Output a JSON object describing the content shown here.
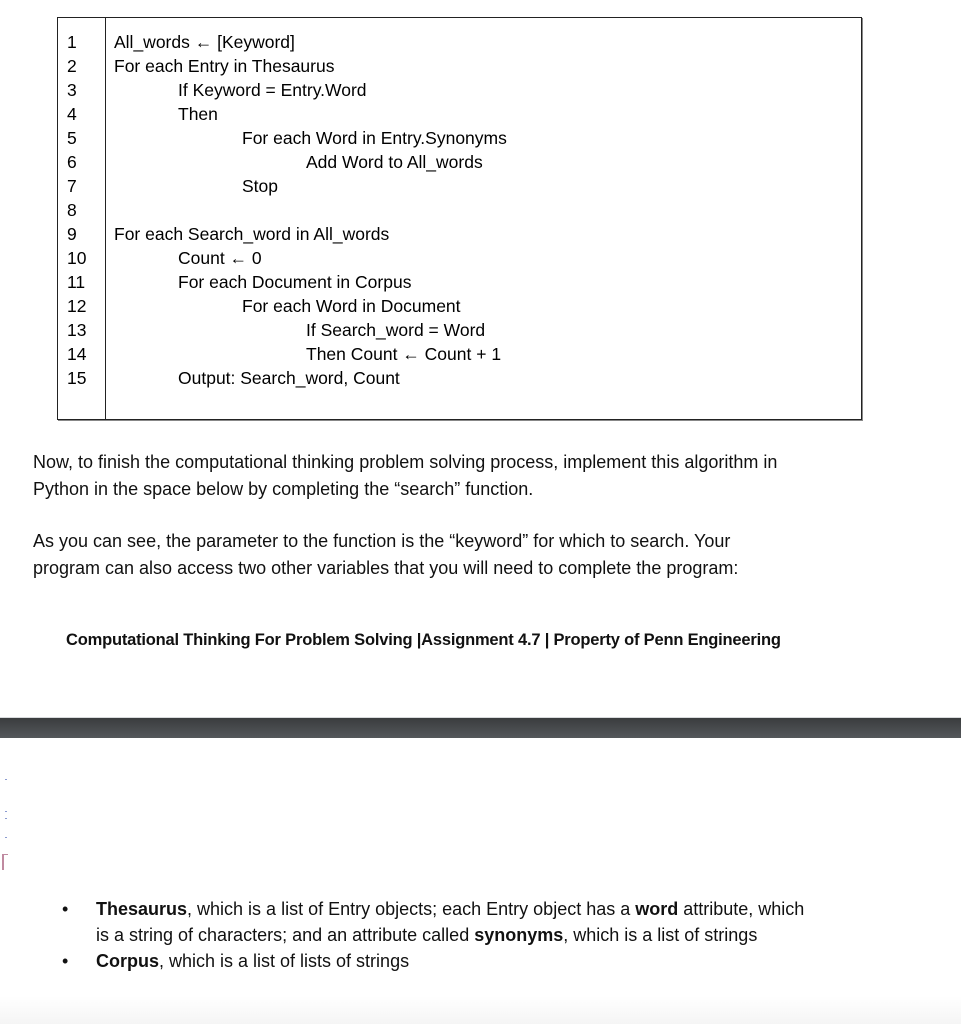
{
  "algorithm": {
    "line_numbers": [
      "1",
      "2",
      "3",
      "4",
      "5",
      "6",
      "7",
      "8",
      "9",
      "10",
      "11",
      "12",
      "13",
      "14",
      "15"
    ],
    "lines": [
      {
        "indent": 0,
        "text": "All_words ← [Keyword]"
      },
      {
        "indent": 0,
        "text": "For each Entry in Thesaurus"
      },
      {
        "indent": 1,
        "text": "If Keyword = Entry.Word"
      },
      {
        "indent": 1,
        "text": "Then"
      },
      {
        "indent": 2,
        "text": "For each Word in Entry.Synonyms"
      },
      {
        "indent": 3,
        "text": "Add Word to All_words"
      },
      {
        "indent": 2,
        "text": "Stop"
      },
      {
        "indent": 0,
        "text": ""
      },
      {
        "indent": 0,
        "text": "For each Search_word in All_words"
      },
      {
        "indent": 1,
        "text": "Count ← 0"
      },
      {
        "indent": 1,
        "text": "For each Document in Corpus"
      },
      {
        "indent": 2,
        "text": "For each Word in Document"
      },
      {
        "indent": 3,
        "text": "If Search_word = Word"
      },
      {
        "indent": 3,
        "text": "Then Count ← Count + 1"
      },
      {
        "indent": 1,
        "text": "Output: Search_word, Count"
      }
    ]
  },
  "paragraphs": {
    "p1_line1": "Now, to finish the computational thinking problem solving process, implement this algorithm in",
    "p1_line2": "Python in the space below by completing the “search” function.",
    "p2_line1": "As you can see, the parameter to the function is the “keyword” for which to search. Your",
    "p2_line2": "program can also access two other variables that you will need to complete the program:"
  },
  "footer": {
    "text": "Computational Thinking For Problem Solving  |Assignment 4.7 | Property of Penn Engineering"
  },
  "bullets": [
    {
      "bullet_glyph": "•",
      "parts": [
        {
          "bold": true,
          "text": "Thesaurus"
        },
        {
          "bold": false,
          "text": ", which is a list of Entry objects; each Entry object has a "
        },
        {
          "bold": true,
          "text": "word"
        },
        {
          "bold": false,
          "text": " attribute, which is a string of characters; and an attribute called "
        },
        {
          "bold": true,
          "text": "synonyms"
        },
        {
          "bold": false,
          "text": ", which is a list of strings"
        }
      ]
    },
    {
      "bullet_glyph": "•",
      "parts": [
        {
          "bold": true,
          "text": "Corpus"
        },
        {
          "bold": false,
          "text": ", which is a list of lists of strings"
        }
      ]
    }
  ]
}
